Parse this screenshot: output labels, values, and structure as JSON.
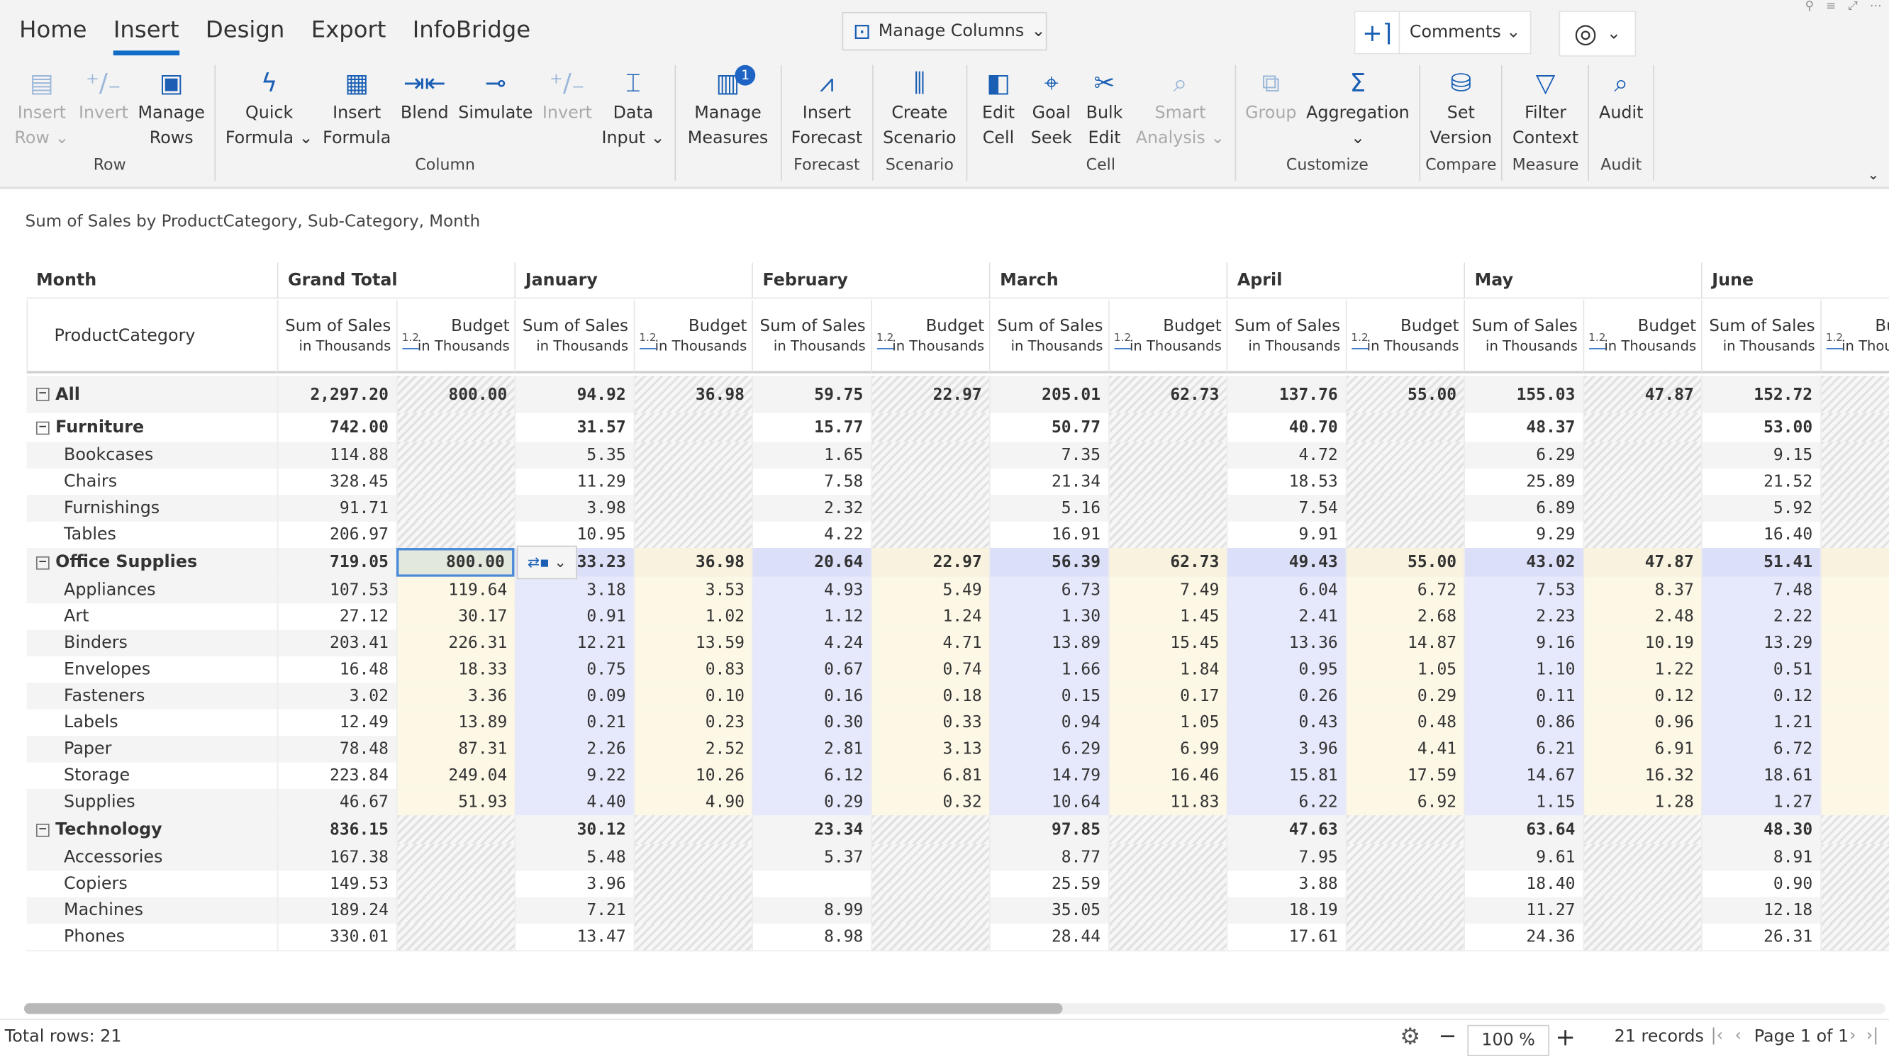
{
  "tabs": [
    {
      "label": "Home"
    },
    {
      "label": "Insert",
      "active": true
    },
    {
      "label": "Design"
    },
    {
      "label": "Export"
    },
    {
      "label": "InfoBridge"
    }
  ],
  "manage_columns": "Manage Columns",
  "comments": "Comments",
  "ribbon": [
    {
      "label": "Row",
      "buttons": [
        {
          "l1": "Insert",
          "l2": "Row ⌄",
          "icon": "▤",
          "disabled": true,
          "name": "insert-row"
        },
        {
          "l1": "Invert",
          "l2": "",
          "icon": "⁺∕₋",
          "disabled": true,
          "name": "invert-row"
        },
        {
          "l1": "Manage",
          "l2": "Rows",
          "icon": "▣",
          "name": "manage-rows"
        }
      ]
    },
    {
      "label": "Column",
      "buttons": [
        {
          "l1": "Quick",
          "l2": "Formula ⌄",
          "icon": "ϟ",
          "name": "quick-formula"
        },
        {
          "l1": "Insert",
          "l2": "Formula",
          "icon": "▦",
          "name": "insert-formula"
        },
        {
          "l1": "Blend",
          "l2": "",
          "icon": "⇥⇤",
          "name": "blend"
        },
        {
          "l1": "Simulate",
          "l2": "",
          "icon": "⊸",
          "name": "simulate"
        },
        {
          "l1": "Invert",
          "l2": "",
          "icon": "⁺∕₋",
          "disabled": true,
          "name": "invert-column"
        },
        {
          "l1": "Data",
          "l2": "Input ⌄",
          "icon": "⌶",
          "name": "data-input"
        }
      ]
    },
    {
      "label": "",
      "buttons": [
        {
          "l1": "Manage",
          "l2": "Measures",
          "icon": "▥",
          "badge": "1",
          "name": "manage-measures"
        }
      ]
    },
    {
      "label": "Forecast",
      "buttons": [
        {
          "l1": "Insert",
          "l2": "Forecast",
          "icon": "⩘",
          "name": "insert-forecast"
        }
      ]
    },
    {
      "label": "Scenario",
      "buttons": [
        {
          "l1": "Create",
          "l2": "Scenario",
          "icon": "⫼",
          "name": "create-scenario"
        }
      ]
    },
    {
      "label": "Cell",
      "buttons": [
        {
          "l1": "Edit",
          "l2": "Cell",
          "icon": "◧",
          "name": "edit-cell"
        },
        {
          "l1": "Goal",
          "l2": "Seek",
          "icon": "⌖",
          "name": "goal-seek"
        },
        {
          "l1": "Bulk",
          "l2": "Edit",
          "icon": "✂",
          "name": "bulk-edit"
        },
        {
          "l1": "Smart",
          "l2": "Analysis ⌄",
          "icon": "⌕",
          "disabled": true,
          "name": "smart-analysis"
        }
      ]
    },
    {
      "label": "Customize",
      "buttons": [
        {
          "l1": "Group",
          "l2": "",
          "icon": "⧉",
          "disabled": true,
          "name": "group"
        },
        {
          "l1": "Aggregation",
          "l2": "⌄",
          "icon": "Σ",
          "name": "aggregation"
        }
      ]
    },
    {
      "label": "Compare",
      "buttons": [
        {
          "l1": "Set",
          "l2": "Version",
          "icon": "⛁",
          "name": "set-version"
        }
      ]
    },
    {
      "label": "Measure",
      "buttons": [
        {
          "l1": "Filter",
          "l2": "Context",
          "icon": "▽",
          "name": "filter-context"
        }
      ]
    },
    {
      "label": "Audit",
      "buttons": [
        {
          "l1": "Audit",
          "l2": "",
          "icon": "⌕",
          "name": "audit"
        }
      ]
    }
  ],
  "subtitle": "Sum of Sales by ProductCategory, Sub-Category, Month",
  "grid": {
    "row_header": "Month",
    "category_header": "ProductCategory",
    "months": [
      "Grand Total",
      "January",
      "February",
      "March",
      "April",
      "May",
      "June"
    ],
    "measure_sales": "Sum of Sales",
    "measure_budget": "Budget",
    "unit": "in Thousands",
    "format_badge": "1.2",
    "rows": [
      {
        "label": "All",
        "type": "all",
        "sales": [
          "2,297.20",
          "94.92",
          "59.75",
          "205.01",
          "137.76",
          "155.03",
          "152.72"
        ],
        "budget": [
          "800.00",
          "36.98",
          "22.97",
          "62.73",
          "55.00",
          "47.87",
          ""
        ]
      },
      {
        "label": "Furniture",
        "type": "group",
        "sales": [
          "742.00",
          "31.57",
          "15.77",
          "50.77",
          "40.70",
          "48.37",
          "53.00"
        ],
        "budget": null
      },
      {
        "label": "Bookcases",
        "type": "leaf",
        "sales": [
          "114.88",
          "5.35",
          "1.65",
          "7.35",
          "4.72",
          "6.29",
          "9.15"
        ],
        "budget": null
      },
      {
        "label": "Chairs",
        "type": "leaf",
        "sales": [
          "328.45",
          "11.29",
          "7.58",
          "21.34",
          "18.53",
          "25.89",
          "21.52"
        ],
        "budget": null
      },
      {
        "label": "Furnishings",
        "type": "leaf",
        "sales": [
          "91.71",
          "3.98",
          "2.32",
          "5.16",
          "7.54",
          "6.89",
          "5.92"
        ],
        "budget": null
      },
      {
        "label": "Tables",
        "type": "leaf",
        "sales": [
          "206.97",
          "10.95",
          "4.22",
          "16.91",
          "9.91",
          "9.29",
          "16.40"
        ],
        "budget": null
      },
      {
        "label": "Office Supplies",
        "type": "group",
        "os": true,
        "sales": [
          "719.05",
          "33.23",
          "20.64",
          "56.39",
          "49.43",
          "43.02",
          "51.41"
        ],
        "budget": [
          "800.00",
          "36.98",
          "22.97",
          "62.73",
          "55.00",
          "47.87",
          ""
        ]
      },
      {
        "label": "Appliances",
        "type": "leaf",
        "os": true,
        "sales": [
          "107.53",
          "3.18",
          "4.93",
          "6.73",
          "6.04",
          "7.53",
          "7.48"
        ],
        "budget": [
          "119.64",
          "3.53",
          "5.49",
          "7.49",
          "6.72",
          "8.37",
          ""
        ]
      },
      {
        "label": "Art",
        "type": "leaf",
        "os": true,
        "sales": [
          "27.12",
          "0.91",
          "1.12",
          "1.30",
          "2.41",
          "2.23",
          "2.22"
        ],
        "budget": [
          "30.17",
          "1.02",
          "1.24",
          "1.45",
          "2.68",
          "2.48",
          ""
        ]
      },
      {
        "label": "Binders",
        "type": "leaf",
        "os": true,
        "sales": [
          "203.41",
          "12.21",
          "4.24",
          "13.89",
          "13.36",
          "9.16",
          "13.29"
        ],
        "budget": [
          "226.31",
          "13.59",
          "4.71",
          "15.45",
          "14.87",
          "10.19",
          ""
        ]
      },
      {
        "label": "Envelopes",
        "type": "leaf",
        "os": true,
        "sales": [
          "16.48",
          "0.75",
          "0.67",
          "1.66",
          "0.95",
          "1.10",
          "0.51"
        ],
        "budget": [
          "18.33",
          "0.83",
          "0.74",
          "1.84",
          "1.05",
          "1.22",
          ""
        ]
      },
      {
        "label": "Fasteners",
        "type": "leaf",
        "os": true,
        "sales": [
          "3.02",
          "0.09",
          "0.16",
          "0.15",
          "0.26",
          "0.11",
          "0.12"
        ],
        "budget": [
          "3.36",
          "0.10",
          "0.18",
          "0.17",
          "0.29",
          "0.12",
          ""
        ]
      },
      {
        "label": "Labels",
        "type": "leaf",
        "os": true,
        "sales": [
          "12.49",
          "0.21",
          "0.30",
          "0.94",
          "0.43",
          "0.86",
          "1.21"
        ],
        "budget": [
          "13.89",
          "0.23",
          "0.33",
          "1.05",
          "0.48",
          "0.96",
          ""
        ]
      },
      {
        "label": "Paper",
        "type": "leaf",
        "os": true,
        "sales": [
          "78.48",
          "2.26",
          "2.81",
          "6.29",
          "3.96",
          "6.21",
          "6.72"
        ],
        "budget": [
          "87.31",
          "2.52",
          "3.13",
          "6.99",
          "4.41",
          "6.91",
          ""
        ]
      },
      {
        "label": "Storage",
        "type": "leaf",
        "os": true,
        "sales": [
          "223.84",
          "9.22",
          "6.12",
          "14.79",
          "15.81",
          "14.67",
          "18.61"
        ],
        "budget": [
          "249.04",
          "10.26",
          "6.81",
          "16.46",
          "17.59",
          "16.32",
          ""
        ]
      },
      {
        "label": "Supplies",
        "type": "leaf",
        "os": true,
        "sales": [
          "46.67",
          "4.40",
          "0.29",
          "10.64",
          "6.22",
          "1.15",
          "1.27"
        ],
        "budget": [
          "51.93",
          "4.90",
          "0.32",
          "11.83",
          "6.92",
          "1.28",
          ""
        ]
      },
      {
        "label": "Technology",
        "type": "group",
        "sales": [
          "836.15",
          "30.12",
          "23.34",
          "97.85",
          "47.63",
          "63.64",
          "48.30"
        ],
        "budget": null
      },
      {
        "label": "Accessories",
        "type": "leaf",
        "sales": [
          "167.38",
          "5.48",
          "5.37",
          "8.77",
          "7.95",
          "9.61",
          "8.91"
        ],
        "budget": null
      },
      {
        "label": "Copiers",
        "type": "leaf",
        "sales": [
          "149.53",
          "3.96",
          "",
          "25.59",
          "3.88",
          "18.40",
          "0.90"
        ],
        "budget": null
      },
      {
        "label": "Machines",
        "type": "leaf",
        "sales": [
          "189.24",
          "7.21",
          "8.99",
          "35.05",
          "18.19",
          "11.27",
          "12.18"
        ],
        "budget": null
      },
      {
        "label": "Phones",
        "type": "leaf",
        "sales": [
          "330.01",
          "13.47",
          "8.98",
          "28.44",
          "17.61",
          "24.36",
          "26.31"
        ],
        "budget": null
      }
    ]
  },
  "footer": {
    "total_rows": "Total rows: 21",
    "zoom": "100 %",
    "records": "21 records",
    "page": "Page 1 of 1"
  },
  "colors": {
    "accent": "#0f6cc7",
    "sales_highlight": "#e6e8fb",
    "budget_highlight": "#fdf8e6",
    "selected_cell": "#e2e8dc"
  }
}
